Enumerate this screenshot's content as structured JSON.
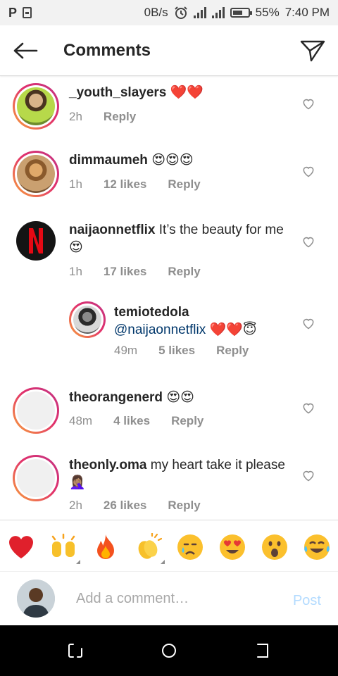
{
  "status_bar": {
    "left_icons": [
      "p-app-icon",
      "clipboard-icon"
    ],
    "speed": "0B/s",
    "battery": "55%",
    "time": "7:40 PM"
  },
  "header": {
    "title": "Comments",
    "back_icon": "arrow-left-icon",
    "send_icon": "paper-plane-icon"
  },
  "comments": [
    {
      "username": "_youth_slayers",
      "text": "❤️❤️",
      "time": "2h",
      "likes": "",
      "reply": "Reply",
      "avatar": "story-ring"
    },
    {
      "username": "dimmaumeh",
      "text": "😍😍😍",
      "time": "1h",
      "likes": "12 likes",
      "reply": "Reply",
      "avatar": "story-ring"
    },
    {
      "username": "naijaonnetflix",
      "text": "It’s the beauty for me 😍",
      "time": "1h",
      "likes": "17 likes",
      "reply": "Reply",
      "avatar": "netflix-logo"
    },
    {
      "username": "temiotedola",
      "mention": "@naijaonnetflix",
      "text": "❤️❤️😇",
      "time": "49m",
      "likes": "5 likes",
      "reply": "Reply",
      "avatar": "story-ring"
    },
    {
      "username": "theorangenerd",
      "text": "😍😍",
      "time": "48m",
      "likes": "4 likes",
      "reply": "Reply",
      "avatar": "story-ring-empty"
    },
    {
      "username": "theonly.oma",
      "text": "my heart take it please 🤦🏽‍♀️",
      "time": "2h",
      "likes": "26 likes",
      "reply": "Reply",
      "avatar": "story-ring-empty"
    }
  ],
  "emoji_bar": [
    "❤️",
    "🙌",
    "🔥",
    "👏",
    "😢",
    "😍",
    "😮",
    "😂"
  ],
  "composer": {
    "placeholder": "Add a comment…",
    "post_label": "Post"
  },
  "nav_bar": [
    "recent-apps-icon",
    "home-icon",
    "back-icon"
  ],
  "colors": {
    "story_gradient_start": "#f9a53a",
    "story_gradient_end": "#c13584",
    "mention": "#00376b",
    "muted": "#8e8e8e",
    "post_disabled": "#b3dbff"
  }
}
